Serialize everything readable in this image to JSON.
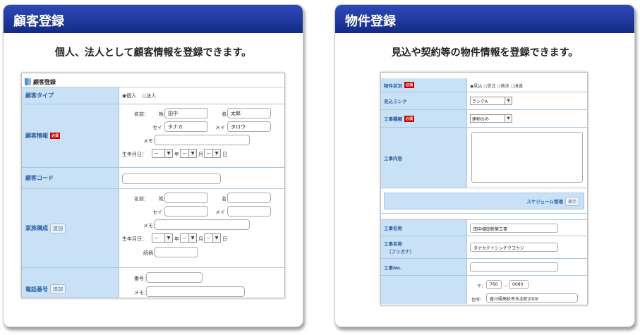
{
  "left": {
    "header": "顧客登録",
    "subtitle": "個人、法人として顧客情報を登録できます。",
    "form": {
      "title": "顧客登録",
      "customer_type": {
        "label": "顧客タイプ",
        "opt1": "◉個人",
        "opt2": "○法人"
      },
      "customer_info": {
        "label": "顧客情報",
        "required": "必須",
        "name_label": "名前：",
        "sei": "姓",
        "sei_value": "田中",
        "mei": "名",
        "mei_value": "太郎",
        "kana_sei": "セイ",
        "kana_sei_value": "タナカ",
        "kana_mei": "メイ",
        "kana_mei_value": "タロウ",
        "memo": "メモ：",
        "birth": "生年月日：",
        "dash": "－",
        "year": "年",
        "month": "月",
        "day": "日"
      },
      "customer_code": {
        "label": "顧客コード"
      },
      "family": {
        "label": "家族構成",
        "add": "追加",
        "name_label": "名前：",
        "sei": "姓",
        "mei": "名",
        "kana_sei": "セイ",
        "kana_mei": "メイ",
        "memo": "メモ：",
        "birth": "生年月日：",
        "dash": "－",
        "year": "年",
        "month": "月",
        "day": "日",
        "relation": "続柄："
      },
      "phone": {
        "label": "電話番号",
        "add": "追加",
        "number": "番号：",
        "memo": "メモ："
      }
    }
  },
  "right": {
    "header": "物件登録",
    "subtitle": "見込や契約等の物件情報を登録できます。",
    "form": {
      "status": {
        "label": "物件状況",
        "required": "必須",
        "options": "◉見込 ○受注 ○他決 ○消滅"
      },
      "rank": {
        "label": "見込ランク",
        "value": "ランクA"
      },
      "type": {
        "label": "工事種類",
        "required": "必須",
        "value": "建物のみ"
      },
      "content": {
        "label": "工事内容"
      },
      "schedule": {
        "label": "スケジュール管理",
        "button": "表示"
      },
      "work_name": {
        "label": "工事名称",
        "value": "田中様邸新築工事"
      },
      "work_kana": {
        "label": "工事名称",
        "label2": "（フリガナ）",
        "value": "タナカテイシンチクコウジ"
      },
      "work_no": {
        "label": "工事No."
      },
      "address": {
        "postal_mark": "〒：",
        "zip1": "760",
        "dash": "－",
        "zip2": "0080",
        "addr_label": "住所：",
        "addr_value": "香川県高松市木太町2000"
      }
    }
  }
}
